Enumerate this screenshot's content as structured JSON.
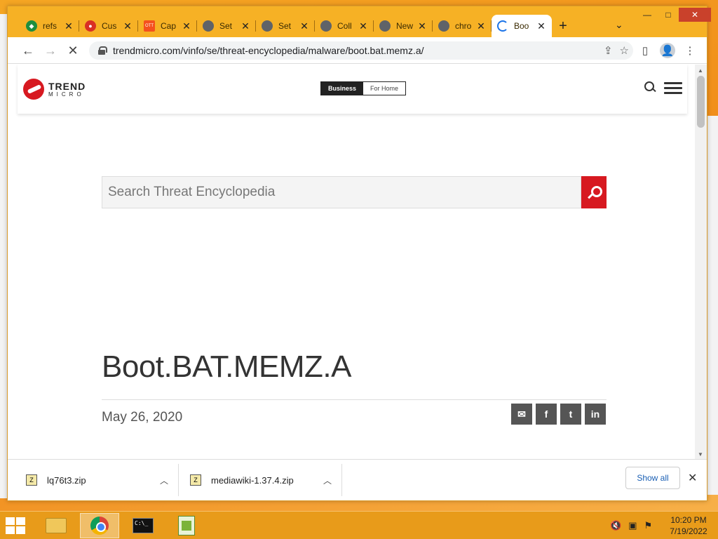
{
  "browser": {
    "tabs": [
      {
        "label": "refs",
        "favicon_color": "#1e8e3e",
        "glyph": "◆"
      },
      {
        "label": "Cus",
        "favicon_color": "#d93025",
        "glyph": "●"
      },
      {
        "label": "Cap",
        "favicon_color": "#f4511e",
        "glyph": "OTT"
      },
      {
        "label": "Set",
        "favicon_color": "#5f6368",
        "glyph": "◉"
      },
      {
        "label": "Set",
        "favicon_color": "#5f6368",
        "glyph": "◉"
      },
      {
        "label": "Coll",
        "favicon_color": "#5f6368",
        "glyph": "◉"
      },
      {
        "label": "New",
        "favicon_color": "#5f6368",
        "glyph": "◎"
      },
      {
        "label": "chro",
        "favicon_color": "#5f6368",
        "glyph": "◎"
      }
    ],
    "active_tab": {
      "label": "Boo",
      "loading": true
    },
    "url": "trendmicro.com/vinfo/se/threat-encyclopedia/malware/boot.bat.memz.a/",
    "window_controls": {
      "minimize": "—",
      "maximize": "□",
      "close": "✕"
    }
  },
  "site": {
    "logo": {
      "line1": "TREND",
      "line2": "MICRO"
    },
    "segment": {
      "business": "Business",
      "home": "For Home"
    },
    "search": {
      "placeholder": "Search Threat Encyclopedia"
    },
    "article": {
      "title": "Boot.BAT.MEMZ.A",
      "date": "May 26, 2020"
    },
    "share_icons": [
      "email-icon",
      "facebook-icon",
      "twitter-icon",
      "linkedin-icon"
    ]
  },
  "downloads": {
    "items": [
      {
        "name": "lq76t3.zip"
      },
      {
        "name": "mediawiki-1.37.4.zip"
      }
    ],
    "show_all": "Show all"
  },
  "taskbar": {
    "time": "10:20 PM",
    "date": "7/19/2022"
  },
  "colors": {
    "accent": "#d71920",
    "taskbar": "#e89b1a",
    "titlebar": "#f6b125"
  }
}
